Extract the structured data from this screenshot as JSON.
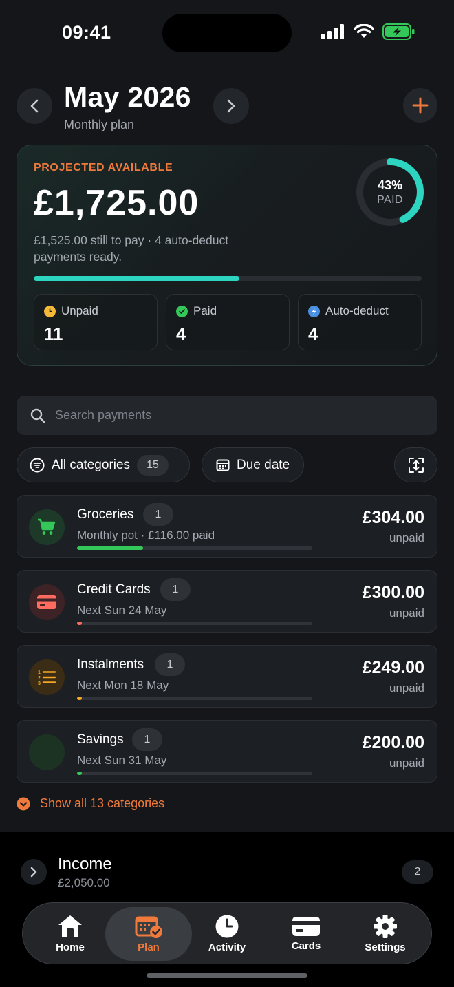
{
  "status_bar": {
    "time": "09:41"
  },
  "header": {
    "title": "May 2026",
    "subtitle": "Monthly plan"
  },
  "summary": {
    "label": "PROJECTED AVAILABLE",
    "amount": "£1,725.00",
    "note": "£1,525.00 still to pay · 4 auto-deduct payments ready.",
    "paid_percent_text": "43%",
    "paid_label": "PAID",
    "paid_fraction": 0.43,
    "progress_fraction": 0.53,
    "stats": [
      {
        "label": "Unpaid",
        "value": "11",
        "color": "#f5b93a"
      },
      {
        "label": "Paid",
        "value": "4",
        "color": "#34c759"
      },
      {
        "label": "Auto-deduct",
        "value": "4",
        "color": "#4a90e2"
      }
    ]
  },
  "search": {
    "placeholder": "Search payments"
  },
  "filters": {
    "categories_label": "All categories",
    "categories_count": "15",
    "sort_label": "Due date"
  },
  "categories": [
    {
      "name": "Groceries",
      "count": "1",
      "subtitle": "Monthly pot · £116.00 paid",
      "amount": "£304.00",
      "status": "unpaid",
      "icon": "cart-icon",
      "color": "#34c759",
      "progress": 0.28
    },
    {
      "name": "Credit Cards",
      "count": "1",
      "subtitle": "Next Sun 24 May",
      "amount": "£300.00",
      "status": "unpaid",
      "icon": "credit-card-icon",
      "color": "#ff6b5e",
      "progress": 0.02
    },
    {
      "name": "Instalments",
      "count": "1",
      "subtitle": "Next Mon 18 May",
      "amount": "£249.00",
      "status": "unpaid",
      "icon": "list-icon",
      "color": "#f5a623",
      "progress": 0.02
    },
    {
      "name": "Savings",
      "count": "1",
      "subtitle": "Next Sun 31 May",
      "amount": "£200.00",
      "status": "unpaid",
      "icon": "savings-icon",
      "color": "#34c759",
      "progress": 0.02
    }
  ],
  "show_all": {
    "label": "Show all 13 categories"
  },
  "income": {
    "title": "Income",
    "amount": "£2,050.00",
    "count": "2"
  },
  "tabs": [
    {
      "label": "Home",
      "icon": "home-icon"
    },
    {
      "label": "Plan",
      "icon": "calendar-check-icon",
      "active": true
    },
    {
      "label": "Activity",
      "icon": "clock-icon"
    },
    {
      "label": "Cards",
      "icon": "card-icon"
    },
    {
      "label": "Settings",
      "icon": "gear-icon"
    }
  ],
  "colors": {
    "accent": "#f07a3c",
    "teal": "#2dd4bf",
    "background": "#141619"
  }
}
